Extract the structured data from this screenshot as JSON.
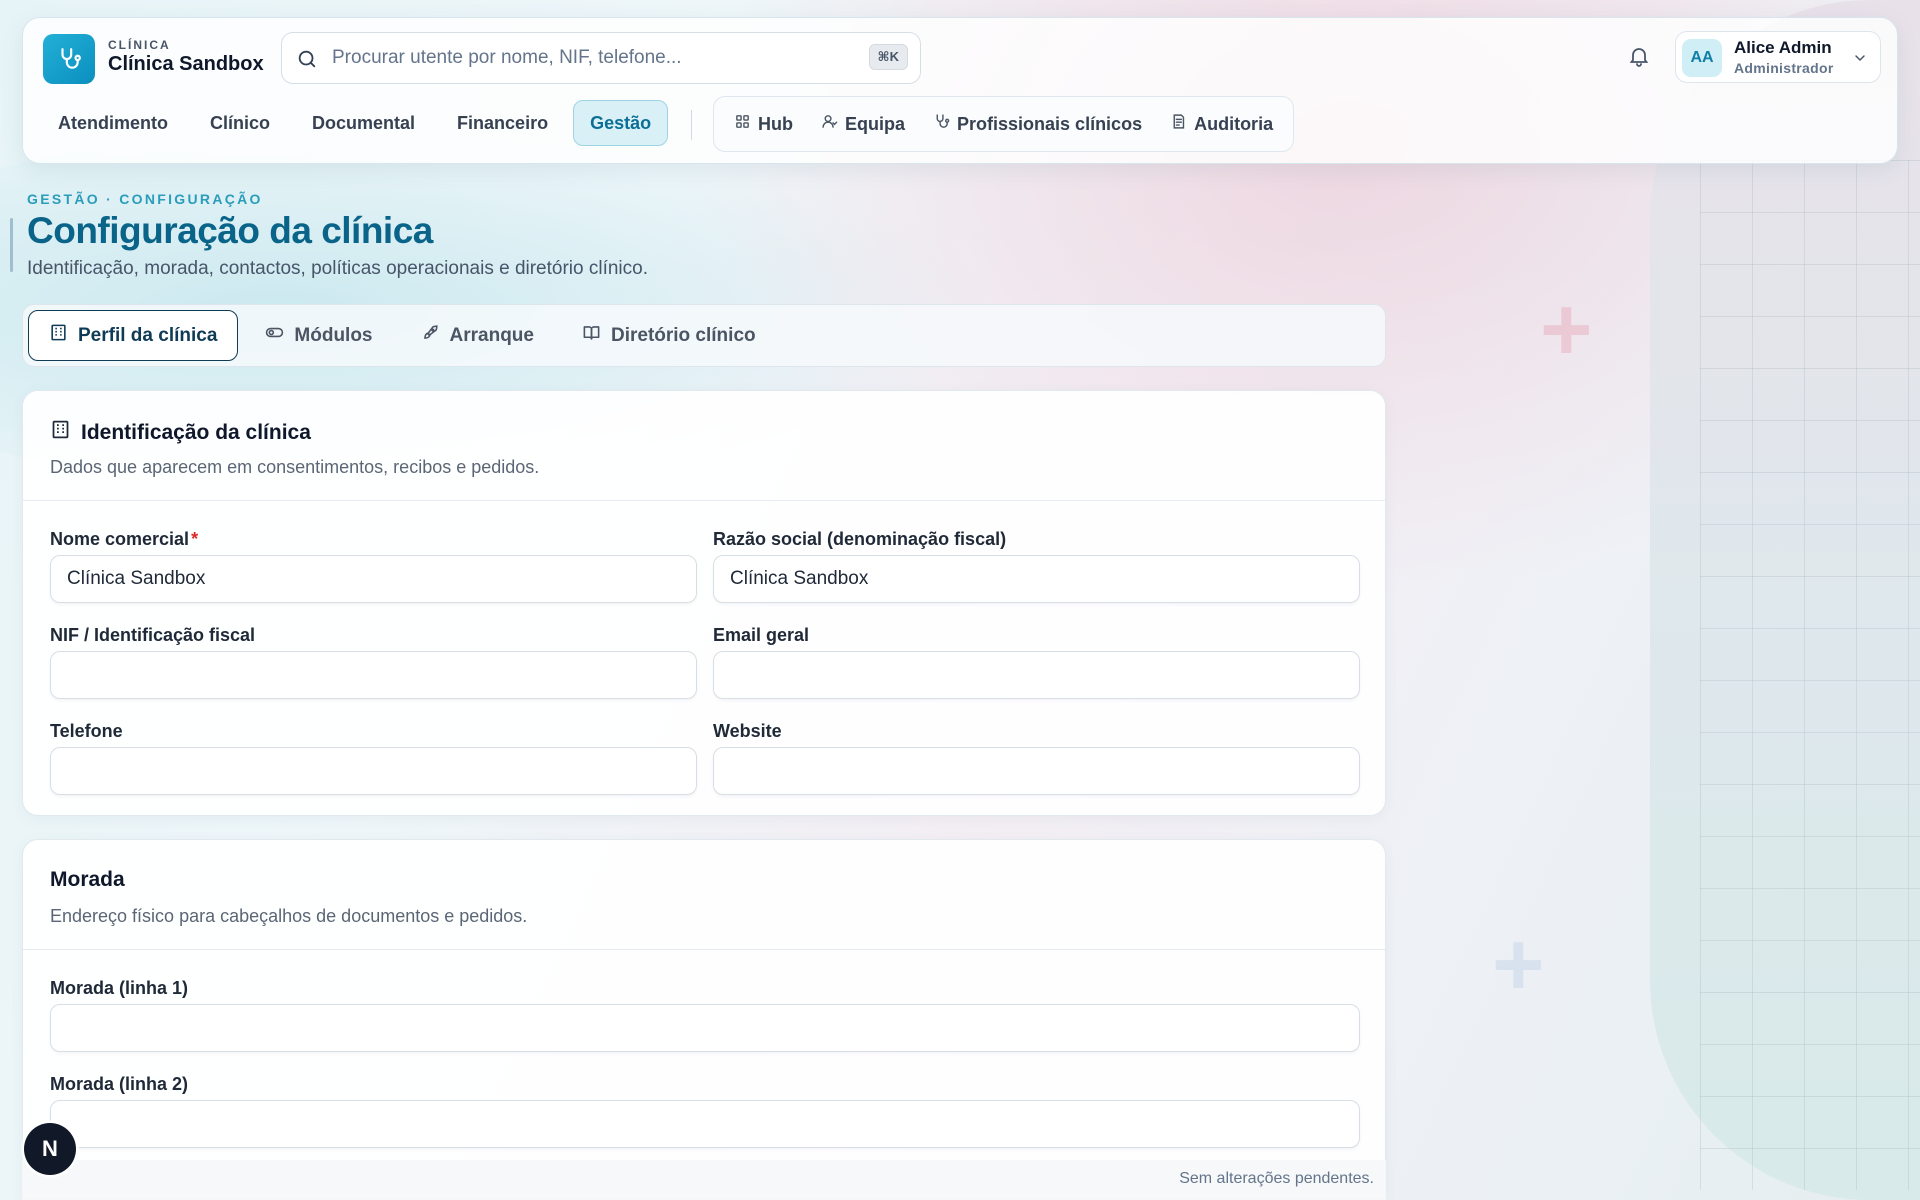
{
  "brand": {
    "kicker": "CLÍNICA",
    "name": "Clínica Sandbox"
  },
  "search": {
    "placeholder": "Procurar utente por nome, NIF, telefone...",
    "shortcut": "⌘K"
  },
  "user": {
    "initials": "AA",
    "name": "Alice Admin",
    "role": "Administrador"
  },
  "nav": {
    "main": [
      "Atendimento",
      "Clínico",
      "Documental",
      "Financeiro",
      "Gestão"
    ],
    "active": "Gestão",
    "sub": [
      {
        "label": "Hub",
        "icon": "grid-icon"
      },
      {
        "label": "Equipa",
        "icon": "users-icon"
      },
      {
        "label": "Profissionais clínicos",
        "icon": "stethoscope-icon"
      },
      {
        "label": "Auditoria",
        "icon": "audit-icon"
      }
    ]
  },
  "page": {
    "kicker": "GESTÃO · CONFIGURAÇÃO",
    "title": "Configuração da clínica",
    "subtitle": "Identificação, morada, contactos, políticas operacionais e diretório clínico."
  },
  "tabs": [
    {
      "label": "Perfil da clínica",
      "icon": "building-icon",
      "active": true
    },
    {
      "label": "Módulos",
      "icon": "toggle-icon",
      "active": false
    },
    {
      "label": "Arranque",
      "icon": "rocket-icon",
      "active": false
    },
    {
      "label": "Diretório clínico",
      "icon": "book-icon",
      "active": false
    }
  ],
  "identification": {
    "title": "Identificação da clínica",
    "description": "Dados que aparecem em consentimentos, recibos e pedidos.",
    "fields": {
      "trade_name": {
        "label": "Nome comercial",
        "value": "Clínica Sandbox",
        "required": "*"
      },
      "legal_name": {
        "label": "Razão social (denominação fiscal)",
        "value": "Clínica Sandbox"
      },
      "nif": {
        "label": "NIF / Identificação fiscal",
        "value": ""
      },
      "email": {
        "label": "Email geral",
        "value": ""
      },
      "phone": {
        "label": "Telefone",
        "value": ""
      },
      "website": {
        "label": "Website",
        "value": ""
      }
    }
  },
  "address": {
    "title": "Morada",
    "description": "Endereço físico para cabeçalhos de documentos e pedidos.",
    "fields": {
      "line1": {
        "label": "Morada (linha 1)",
        "value": ""
      },
      "line2": {
        "label": "Morada (linha 2)",
        "value": ""
      }
    }
  },
  "status": {
    "text": "Sem alterações pendentes."
  },
  "fab": {
    "label": "N"
  },
  "colors": {
    "primary": "#0b8fbf",
    "title": "#0a6489",
    "active_tab_border": "#0f3b57",
    "required": "#dc2626"
  }
}
